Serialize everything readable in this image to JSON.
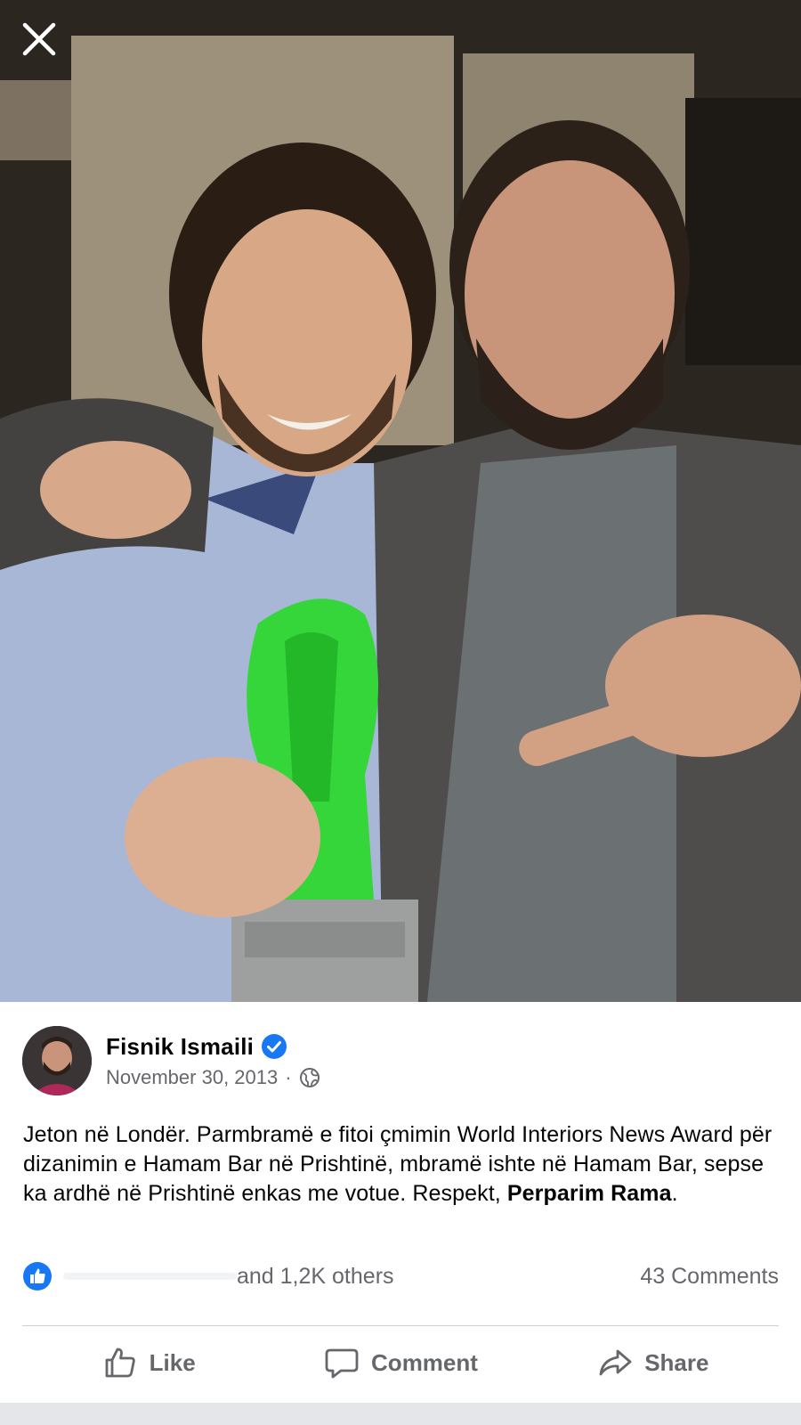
{
  "viewer": {
    "close_icon": "close-icon"
  },
  "post": {
    "author": {
      "name": "Fisnik Ismaili",
      "verified": true,
      "verified_color": "#1877f2"
    },
    "date": "November 30, 2013",
    "separator": "·",
    "audience_icon": "globe-icon",
    "text_before_mention": "Jeton në Londër. Parmbramë e fitoi çmimin World Interiors News Award për dizanimin e Hamam Bar në Prishtinë, mbramë ishte në Hamam Bar, sepse ka ardhë në Prishtinë enkas me votue. Respekt, ",
    "mention": "Perparim Rama",
    "text_after_mention": "."
  },
  "engagement": {
    "reaction_icon": "like-icon",
    "reaction_color": "#1877f2",
    "others_text": "and 1,2K others",
    "comments_text": "43 Comments"
  },
  "actions": {
    "like_label": "Like",
    "comment_label": "Comment",
    "share_label": "Share"
  },
  "colors": {
    "secondary_text": "#65676b",
    "divider": "#ced0d4",
    "accent": "#1877f2"
  }
}
